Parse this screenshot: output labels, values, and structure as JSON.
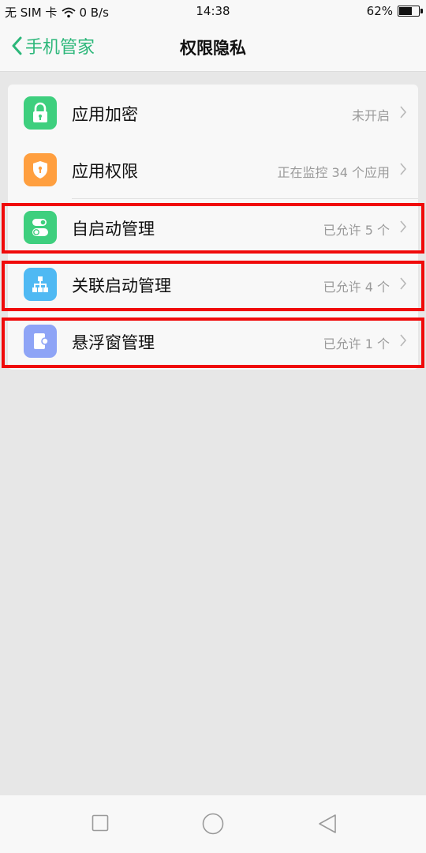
{
  "status_bar": {
    "sim": "无 SIM 卡",
    "speed": "0 B/s",
    "time": "14:38",
    "battery_text": "62%",
    "battery_level": 0.62
  },
  "header": {
    "back_label": "手机管家",
    "title": "权限隐私"
  },
  "list": {
    "items": [
      {
        "label": "应用加密",
        "value": "未开启",
        "icon": "lock-icon",
        "color": "#3ecf7e"
      },
      {
        "label": "应用权限",
        "value": "正在监控 34 个应用",
        "icon": "shield-icon",
        "color": "#ff9f3f"
      },
      {
        "label": "自启动管理",
        "value": "已允许 5 个",
        "icon": "toggle-icon",
        "color": "#3ecf7e"
      },
      {
        "label": "关联启动管理",
        "value": "已允许 4 个",
        "icon": "hierarchy-icon",
        "color": "#4fb9f3"
      },
      {
        "label": "悬浮窗管理",
        "value": "已允许 1 个",
        "icon": "floating-window-icon",
        "color": "#8ea4f6"
      }
    ]
  },
  "colors": {
    "accent": "#2cb77a",
    "highlight": "#f00a0a"
  }
}
